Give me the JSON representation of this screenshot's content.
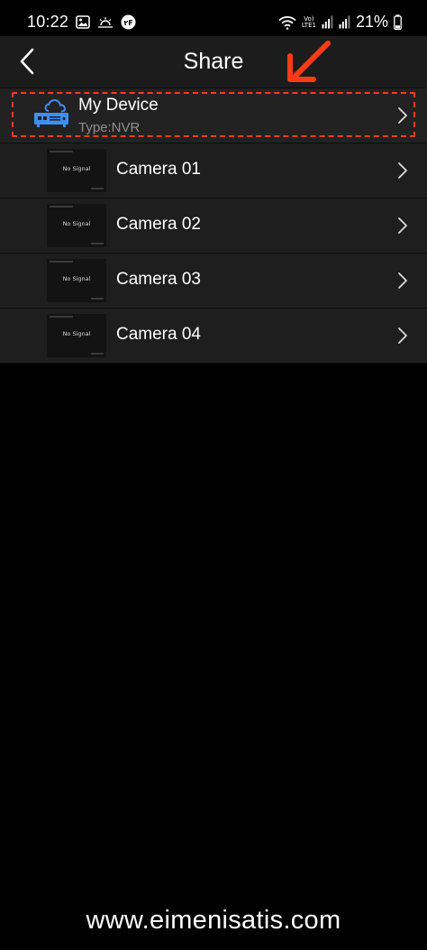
{
  "status_bar": {
    "time": "10:22",
    "battery_percent": "21%",
    "lte_label_top": "Vo)",
    "lte_label_bottom": "LTE1",
    "notification_badge": "۲F",
    "icons": [
      "image-icon",
      "weather-sunrise-icon",
      "wifi-icon",
      "signal-icon",
      "battery-icon"
    ]
  },
  "header": {
    "title": "Share",
    "back_icon": "chevron-left-icon"
  },
  "annotation": {
    "arrow_color": "#ff3b16",
    "highlight_color": "#ff3b16"
  },
  "device": {
    "name": "My Device",
    "type": "Type:NVR",
    "icon": "nvr-cloud-icon",
    "icon_color": "#3d8ff1"
  },
  "cameras": [
    {
      "name": "Camera 01",
      "thumbnail_text": "No Signal"
    },
    {
      "name": "Camera 02",
      "thumbnail_text": "No Signal"
    },
    {
      "name": "Camera 03",
      "thumbnail_text": "No Signal"
    },
    {
      "name": "Camera 04",
      "thumbnail_text": "No Signal"
    }
  ],
  "watermark": "www.eimenisatis.com"
}
